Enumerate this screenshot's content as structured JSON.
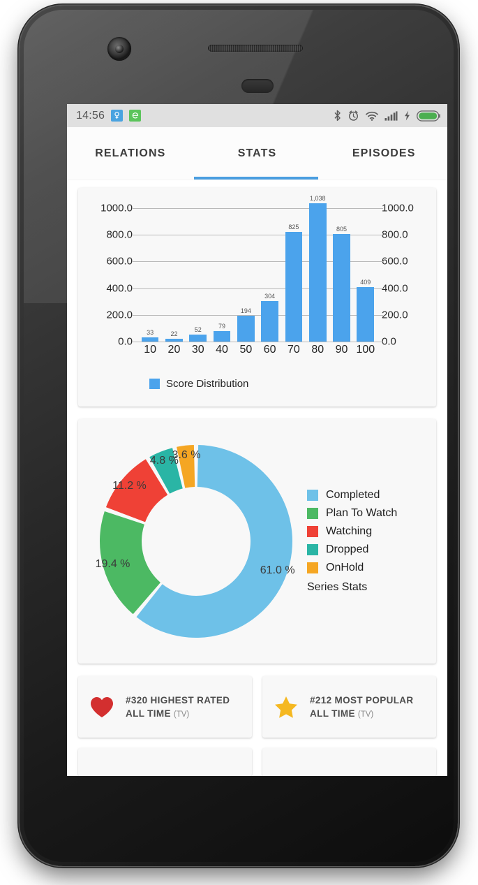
{
  "statusbar": {
    "time": "14:56",
    "notifications": [
      {
        "name": "app-notification-blue",
        "color": "#4aa3e0",
        "glyph": "♀"
      },
      {
        "name": "app-notification-green",
        "color": "#5bc45b",
        "glyph": "ə"
      }
    ],
    "icons": [
      "bluetooth-icon",
      "alarm-icon",
      "wifi-icon",
      "signal-icon",
      "charging-bolt-icon",
      "battery-icon"
    ],
    "battery_color": "#4caf50"
  },
  "tabs": [
    {
      "label": "RELATIONS",
      "active": false
    },
    {
      "label": "STATS",
      "active": true
    },
    {
      "label": "EPISODES",
      "active": false
    }
  ],
  "accent_color": "#4a9ee0",
  "chart_data": [
    {
      "type": "bar",
      "title": "",
      "categories": [
        "10",
        "20",
        "30",
        "40",
        "50",
        "60",
        "70",
        "80",
        "90",
        "100"
      ],
      "values": [
        33,
        22,
        52,
        79,
        194,
        304,
        825,
        1038,
        805,
        409
      ],
      "value_labels": [
        "33",
        "22",
        "52",
        "79",
        "194",
        "304",
        "825",
        "1,038",
        "805",
        "409"
      ],
      "legend": [
        "Score Distribution"
      ],
      "legend_position": "bottom-left",
      "series_color": "#4ba3ec",
      "ylim": [
        0,
        1100
      ],
      "yticks": [
        0,
        200,
        400,
        600,
        800,
        1000
      ],
      "ytick_labels": [
        "0.0",
        "200.0",
        "400.0",
        "600.0",
        "800.0",
        "1000.0"
      ],
      "dual_axis": true,
      "grid": true,
      "xlabel": "",
      "ylabel": ""
    },
    {
      "type": "pie",
      "variant": "donut",
      "title": "Series Stats",
      "categories": [
        "Completed",
        "Plan To Watch",
        "Watching",
        "Dropped",
        "OnHold"
      ],
      "values": [
        61.0,
        19.4,
        11.2,
        4.8,
        3.6
      ],
      "value_labels": [
        "61.0 %",
        "19.4 %",
        "11.2 %",
        "4.8 %",
        "3.6 %"
      ],
      "colors": [
        "#6ec1e8",
        "#4cb963",
        "#ef4136",
        "#2ab5a5",
        "#f5a623"
      ],
      "legend_position": "right"
    }
  ],
  "rank_cards": [
    {
      "icon": "heart-icon",
      "icon_color": "#d32f2f",
      "line1": "#320 HIGHEST RATED",
      "line2": "ALL TIME",
      "suffix": "(TV)"
    },
    {
      "icon": "star-icon",
      "icon_color": "#f5b821",
      "line1": "#212 MOST POPULAR",
      "line2": "ALL TIME",
      "suffix": "(TV)"
    }
  ]
}
